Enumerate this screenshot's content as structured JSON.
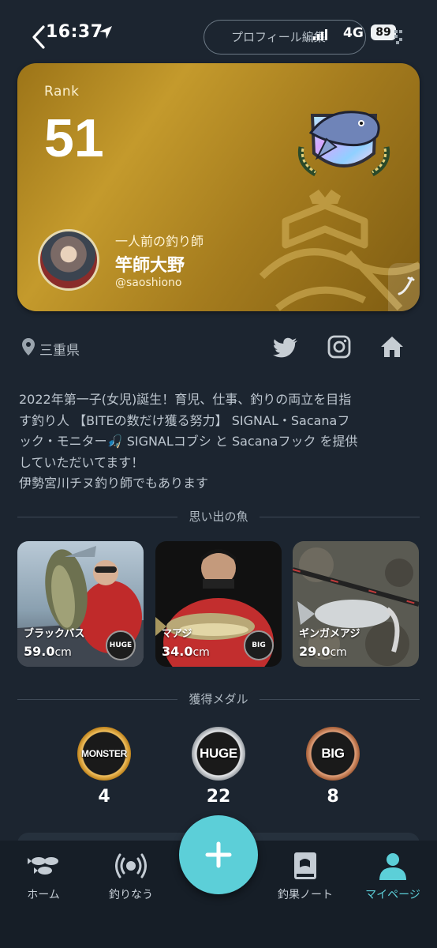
{
  "status_bar": {
    "time": "16:37",
    "network": "4G",
    "battery": "89"
  },
  "header": {
    "profile_edit_label": "プロフィール編集"
  },
  "rank_card": {
    "rank_label": "Rank",
    "rank_value": "51",
    "user_title": "一人前の釣り師",
    "user_name": "竿師大野",
    "user_handle": "@saoshiono",
    "card_color": "#b88d26",
    "emblem_icon": "bass-emblem-icon"
  },
  "profile": {
    "location": "三重県",
    "social_icons": [
      "twitter-icon",
      "instagram-icon",
      "home-link-icon"
    ],
    "bio_lines": [
      "2022年第一子(女児)誕生！育児、仕事、釣りの両立を目指",
      "す釣り人 【BITEの数だけ獲る努力】 SIGNAL・Sacanaフ",
      "ック・モニター🎣 SIGNALコブシ と Sacanaフック を提供",
      "していただいてます！",
      "伊勢宮川チヌ釣り師でもあります"
    ]
  },
  "memorable_fish": {
    "section_title": "思い出の魚",
    "items": [
      {
        "name": "ブラックバス",
        "size": "59.0",
        "unit": "cm",
        "badge": "HUGE"
      },
      {
        "name": "マアジ",
        "size": "34.0",
        "unit": "cm",
        "badge": "BIG"
      },
      {
        "name": "ギンガメアジ",
        "size": "29.0",
        "unit": "cm",
        "badge": ""
      }
    ]
  },
  "medals": {
    "section_title": "獲得メダル",
    "items": [
      {
        "label": "MONSTER",
        "count": "4",
        "color": "#d99a2b"
      },
      {
        "label": "HUGE",
        "count": "22",
        "color": "#a8acb0"
      },
      {
        "label": "BIG",
        "count": "8",
        "color": "#b06a3d"
      }
    ]
  },
  "bottom_nav": {
    "items": [
      {
        "label": "ホーム",
        "icon": "fish-home-icon"
      },
      {
        "label": "釣りなう",
        "icon": "broadcast-icon"
      },
      {
        "label": "釣果ノート",
        "icon": "notebook-icon"
      },
      {
        "label": "マイページ",
        "icon": "person-icon",
        "active": true
      }
    ],
    "fab_icon": "plus-icon",
    "accent_color": "#5ccfd8"
  }
}
